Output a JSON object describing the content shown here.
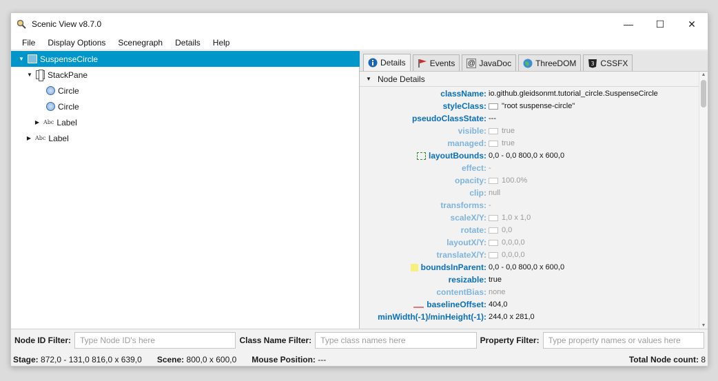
{
  "window": {
    "title": "Scenic View v8.7.0",
    "minimize": "—",
    "maximize": "☐",
    "close": "✕"
  },
  "menu": [
    "File",
    "Display Options",
    "Scenegraph",
    "Details",
    "Help"
  ],
  "tree": [
    {
      "label": "SuspenseCircle",
      "icon": "scene-icon",
      "expanded": true,
      "selected": true
    },
    {
      "label": "StackPane",
      "icon": "stackpane-icon",
      "expanded": true
    },
    {
      "label": "Circle",
      "icon": "circle-icon"
    },
    {
      "label": "Circle",
      "icon": "circle-icon"
    },
    {
      "label": "Label",
      "icon": "label-icon",
      "abc": "Abc",
      "collapsed": true
    },
    {
      "label": "Label",
      "icon": "label-icon",
      "abc": "Abc",
      "collapsed": true
    }
  ],
  "tabs": [
    {
      "label": "Details",
      "icon": "info-icon"
    },
    {
      "label": "Events",
      "icon": "flag-icon"
    },
    {
      "label": "JavaDoc",
      "icon": "at-icon"
    },
    {
      "label": "ThreeDOM",
      "icon": "globe-icon"
    },
    {
      "label": "CSSFX",
      "icon": "css3-icon"
    }
  ],
  "section": {
    "title": "Node Details"
  },
  "properties": [
    {
      "name": "className:",
      "value": "io.github.gleidsonmt.tutorial_circle.SuspenseCircle"
    },
    {
      "name": "styleClass:",
      "value": "\"root suspense-circle\"",
      "check": true
    },
    {
      "name": "pseudoClassState:",
      "value": "---"
    },
    {
      "name": "visible:",
      "value": "true",
      "check": true,
      "dim": true
    },
    {
      "name": "managed:",
      "value": "true",
      "check": true,
      "dim": true
    },
    {
      "name": "layoutBounds:",
      "value": "0,0 - 0,0  800,0 x 600,0",
      "marker": "layoutbounds"
    },
    {
      "name": "effect:",
      "value": "-",
      "dim": true
    },
    {
      "name": "opacity:",
      "value": "100.0%",
      "check": true,
      "dim": true
    },
    {
      "name": "clip:",
      "value": "null",
      "dim": true
    },
    {
      "name": "transforms:",
      "value": "-",
      "dim": true
    },
    {
      "name": "scaleX/Y:",
      "value": "1,0 x 1,0",
      "check": true,
      "dim": true
    },
    {
      "name": "rotate:",
      "value": "0,0",
      "check": true,
      "dim": true
    },
    {
      "name": "layoutX/Y:",
      "value": "0,0,0,0",
      "check": true,
      "dim": true
    },
    {
      "name": "translateX/Y:",
      "value": "0,0,0,0",
      "check": true,
      "dim": true
    },
    {
      "name": "boundsInParent:",
      "value": "0,0 - 0,0  800,0 x 600,0",
      "marker": "boundsinparent"
    },
    {
      "name": "resizable:",
      "value": "true"
    },
    {
      "name": "contentBias:",
      "value": "none",
      "dim": true
    },
    {
      "name": "baselineOffset:",
      "value": "404,0",
      "marker": "baseline"
    },
    {
      "name": "minWidth(-1)/minHeight(-1):",
      "value": "244,0 x 281,0"
    }
  ],
  "filters": {
    "node_id_label": "Node ID Filter:",
    "node_id_placeholder": "Type Node ID's here",
    "class_label": "Class Name Filter:",
    "class_placeholder": "Type class names here",
    "property_label": "Property Filter:",
    "property_placeholder": "Type property names or values here"
  },
  "status": {
    "stage_label": "Stage:",
    "stage_value": "872,0 - 131,0  816,0 x 639,0",
    "scene_label": "Scene:",
    "scene_value": "800,0 x 600,0",
    "mouse_label": "Mouse Position:",
    "mouse_value": "---",
    "total_label": "Total Node count:",
    "total_value": "8"
  },
  "colors": {
    "selection": "#0096c9",
    "prop_name": "#0a6fbf",
    "prop_name_dim": "#7fb3dd"
  }
}
